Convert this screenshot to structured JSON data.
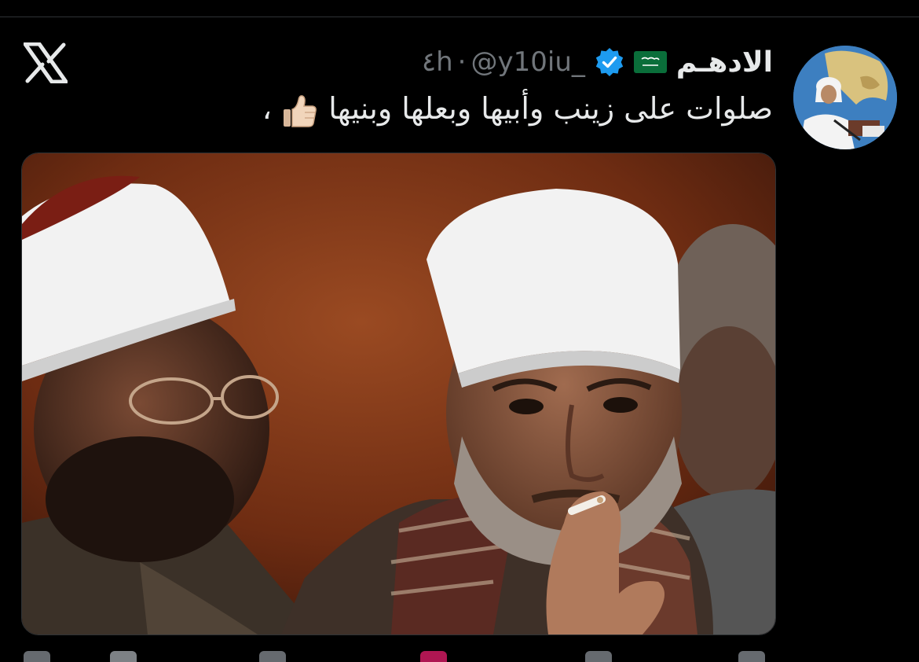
{
  "post": {
    "author_name": "الادهـم",
    "author_flag": "saudi-flag-icon",
    "author_handle": "@y10iu_",
    "separator": "·",
    "time_ago": "٤h",
    "text": "صلوات على زينب وأبيها وبعلها وبنيها",
    "text_trailing": "،",
    "emoji": "thumbs-up-icon"
  },
  "app": {
    "logo": "x-logo-icon"
  },
  "colors": {
    "background": "#000000",
    "text": "#e7e9ea",
    "muted": "#71767b",
    "verified": "#1d9bf0"
  }
}
